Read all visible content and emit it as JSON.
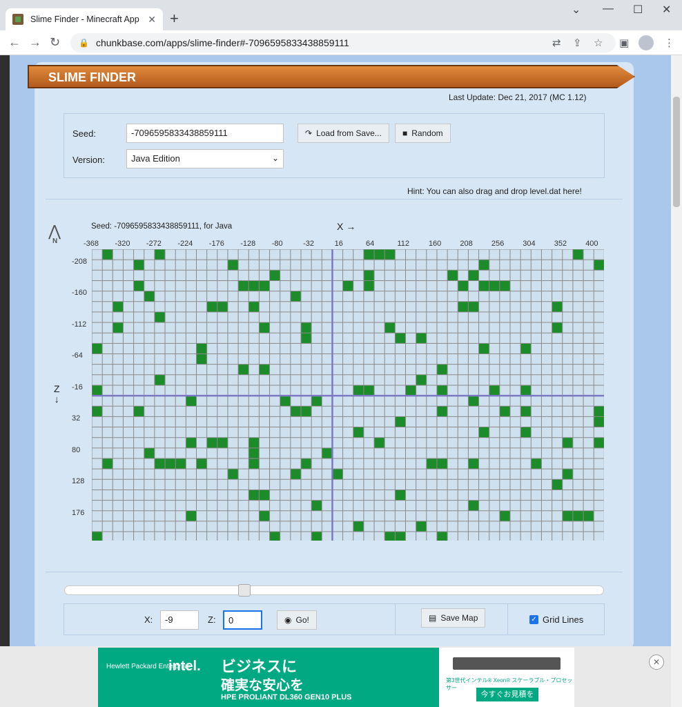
{
  "browser": {
    "tab_title": "Slime Finder - Minecraft App",
    "url": "chunkbase.com/apps/slime-finder#-7096595833438859111"
  },
  "app": {
    "title": "SLIME FINDER",
    "last_update": "Last Update: Dec 21, 2017 (MC 1.12)",
    "seed_label": "Seed:",
    "seed_value": "-7096595833438859111",
    "load_button": "Load from Save...",
    "random_button": "Random",
    "version_label": "Version:",
    "version_value": "Java Edition",
    "hint": "Hint: You can also drag and drop level.dat here!",
    "seed_info": "Seed: -7096595833438859111, for Java",
    "x_axis_label": "X →",
    "z_axis_label": "Z",
    "z_arrow": "↓",
    "compass_label": "N",
    "x_ticks": [
      "-368",
      "-320",
      "-272",
      "-224",
      "-176",
      "-128",
      "-80",
      "-32",
      "16",
      "64",
      "112",
      "160",
      "208",
      "256",
      "304",
      "352",
      "400"
    ],
    "z_ticks": [
      "-208",
      "-160",
      "-112",
      "-64",
      "-16",
      "32",
      "80",
      "128",
      "176"
    ],
    "x_input_label": "X:",
    "x_input_value": "-9",
    "z_input_label": "Z:",
    "z_input_value": "0",
    "go_button": "Go!",
    "save_map_button": "Save Map",
    "grid_lines_label": "Grid Lines",
    "grid_lines_checked": true,
    "slider_value": 0.33
  },
  "slime_map": {
    "cols": 49,
    "rows": 28,
    "axis_col": 23,
    "axis_row": 14,
    "chunks": [
      [
        1,
        0
      ],
      [
        6,
        0
      ],
      [
        26,
        0
      ],
      [
        27,
        0
      ],
      [
        28,
        0
      ],
      [
        46,
        0
      ],
      [
        4,
        1
      ],
      [
        13,
        1
      ],
      [
        37,
        1
      ],
      [
        48,
        1
      ],
      [
        17,
        2
      ],
      [
        26,
        2
      ],
      [
        34,
        2
      ],
      [
        36,
        2
      ],
      [
        4,
        3
      ],
      [
        14,
        3
      ],
      [
        15,
        3
      ],
      [
        16,
        3
      ],
      [
        24,
        3
      ],
      [
        26,
        3
      ],
      [
        35,
        3
      ],
      [
        37,
        3
      ],
      [
        38,
        3
      ],
      [
        39,
        3
      ],
      [
        5,
        4
      ],
      [
        19,
        4
      ],
      [
        2,
        5
      ],
      [
        11,
        5
      ],
      [
        12,
        5
      ],
      [
        15,
        5
      ],
      [
        35,
        5
      ],
      [
        36,
        5
      ],
      [
        44,
        5
      ],
      [
        6,
        6
      ],
      [
        2,
        7
      ],
      [
        16,
        7
      ],
      [
        20,
        7
      ],
      [
        28,
        7
      ],
      [
        44,
        7
      ],
      [
        20,
        8
      ],
      [
        29,
        8
      ],
      [
        31,
        8
      ],
      [
        0,
        9
      ],
      [
        10,
        9
      ],
      [
        37,
        9
      ],
      [
        41,
        9
      ],
      [
        10,
        10
      ],
      [
        14,
        11
      ],
      [
        16,
        11
      ],
      [
        33,
        11
      ],
      [
        6,
        12
      ],
      [
        31,
        12
      ],
      [
        0,
        13
      ],
      [
        25,
        13
      ],
      [
        26,
        13
      ],
      [
        30,
        13
      ],
      [
        33,
        13
      ],
      [
        38,
        13
      ],
      [
        41,
        13
      ],
      [
        9,
        14
      ],
      [
        18,
        14
      ],
      [
        21,
        14
      ],
      [
        36,
        14
      ],
      [
        0,
        15
      ],
      [
        4,
        15
      ],
      [
        19,
        15
      ],
      [
        20,
        15
      ],
      [
        33,
        15
      ],
      [
        39,
        15
      ],
      [
        41,
        15
      ],
      [
        48,
        15
      ],
      [
        29,
        16
      ],
      [
        48,
        16
      ],
      [
        25,
        17
      ],
      [
        37,
        17
      ],
      [
        41,
        17
      ],
      [
        9,
        18
      ],
      [
        11,
        18
      ],
      [
        12,
        18
      ],
      [
        15,
        18
      ],
      [
        27,
        18
      ],
      [
        45,
        18
      ],
      [
        48,
        18
      ],
      [
        5,
        19
      ],
      [
        15,
        19
      ],
      [
        22,
        19
      ],
      [
        1,
        20
      ],
      [
        6,
        20
      ],
      [
        7,
        20
      ],
      [
        8,
        20
      ],
      [
        10,
        20
      ],
      [
        15,
        20
      ],
      [
        20,
        20
      ],
      [
        32,
        20
      ],
      [
        33,
        20
      ],
      [
        36,
        20
      ],
      [
        42,
        20
      ],
      [
        13,
        21
      ],
      [
        19,
        21
      ],
      [
        23,
        21
      ],
      [
        45,
        21
      ],
      [
        44,
        22
      ],
      [
        15,
        23
      ],
      [
        16,
        23
      ],
      [
        29,
        23
      ],
      [
        21,
        24
      ],
      [
        36,
        24
      ],
      [
        9,
        25
      ],
      [
        16,
        25
      ],
      [
        39,
        25
      ],
      [
        45,
        25
      ],
      [
        46,
        25
      ],
      [
        47,
        25
      ],
      [
        25,
        26
      ],
      [
        31,
        26
      ],
      [
        0,
        27
      ],
      [
        17,
        27
      ],
      [
        21,
        27
      ],
      [
        28,
        27
      ],
      [
        29,
        27
      ],
      [
        33,
        27
      ]
    ]
  },
  "ad": {
    "hpe": "Hewlett Packard\nEnterprise",
    "intel": "intel.",
    "line1": "ビジネスに",
    "line2": "確実な安心を",
    "product": "HPE PROLIANT DL360 GEN10 PLUS",
    "desc": "第3世代インテル® Xeon® スケーラブル・プロセッサー",
    "cta": "今すぐお見積を"
  }
}
